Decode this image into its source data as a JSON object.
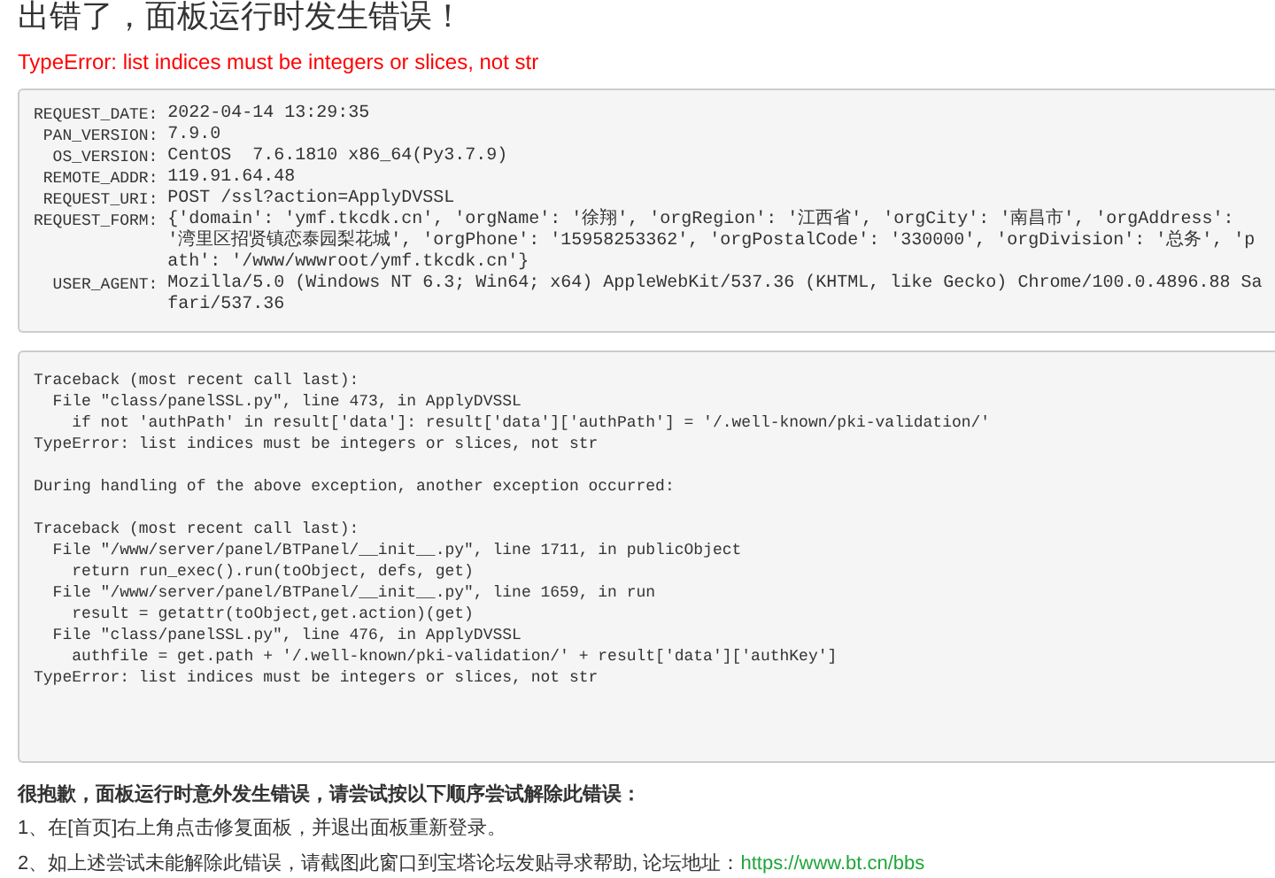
{
  "title": "出错了，面板运行时发生错误！",
  "error_message": "TypeError: list indices must be integers or slices, not str",
  "request_info": [
    {
      "label": "REQUEST_DATE:",
      "value": "2022-04-14 13:29:35"
    },
    {
      "label": "PAN_VERSION:",
      "value": "7.9.0"
    },
    {
      "label": "OS_VERSION:",
      "value": "CentOS  7.6.1810 x86_64(Py3.7.9)"
    },
    {
      "label": "REMOTE_ADDR:",
      "value": "119.91.64.48"
    },
    {
      "label": "REQUEST_URI:",
      "value": "POST /ssl?action=ApplyDVSSL"
    },
    {
      "label": "REQUEST_FORM:",
      "value": "{'domain': 'ymf.tkcdk.cn', 'orgName': '徐翔', 'orgRegion': '江西省', 'orgCity': '南昌市', 'orgAddress': '湾里区招贤镇恋泰园梨花城', 'orgPhone': '15958253362', 'orgPostalCode': '330000', 'orgDivision': '总务', 'path': '/www/wwwroot/ymf.tkcdk.cn'}"
    },
    {
      "label": "USER_AGENT:",
      "value": "Mozilla/5.0 (Windows NT 6.3; Win64; x64) AppleWebKit/537.36 (KHTML, like Gecko) Chrome/100.0.4896.88 Safari/537.36"
    }
  ],
  "traceback": [
    {
      "lines": [
        {
          "kind": "header",
          "text": "Traceback (most recent call last):"
        },
        {
          "kind": "file",
          "text": "File \"class/panelSSL.py\", line 473, in ApplyDVSSL"
        },
        {
          "kind": "code",
          "text": "if not 'authPath' in result['data']: result['data']['authPath'] = '/.well-known/pki-validation/'"
        },
        {
          "kind": "header",
          "text": "TypeError: list indices must be integers or slices, not str"
        }
      ]
    },
    {
      "lines": [
        {
          "kind": "header",
          "text": "During handling of the above exception, another exception occurred:"
        }
      ]
    },
    {
      "lines": [
        {
          "kind": "header",
          "text": "Traceback (most recent call last):"
        },
        {
          "kind": "file",
          "text": "File \"/www/server/panel/BTPanel/__init__.py\", line 1711, in publicObject"
        },
        {
          "kind": "code",
          "text": "return run_exec().run(toObject, defs, get)"
        },
        {
          "kind": "file",
          "text": "File \"/www/server/panel/BTPanel/__init__.py\", line 1659, in run"
        },
        {
          "kind": "code",
          "text": "result = getattr(toObject,get.action)(get)"
        },
        {
          "kind": "file",
          "text": "File \"class/panelSSL.py\", line 476, in ApplyDVSSL"
        },
        {
          "kind": "code",
          "text": "authfile = get.path + '/.well-known/pki-validation/' + result['data']['authKey']"
        },
        {
          "kind": "header",
          "text": "TypeError: list indices must be integers or slices, not str"
        }
      ]
    }
  ],
  "help": {
    "heading": "很抱歉，面板运行时意外发生错误，请尝试按以下顺序尝试解除此错误：",
    "steps": [
      {
        "text": "1、在[首页]右上角点击修复面板，并退出面板重新登录。"
      },
      {
        "text": "2、如上述尝试未能解除此错误，请截图此窗口到宝塔论坛发贴寻求帮助, 论坛地址：",
        "link": "https://www.bt.cn/bbs"
      }
    ]
  }
}
